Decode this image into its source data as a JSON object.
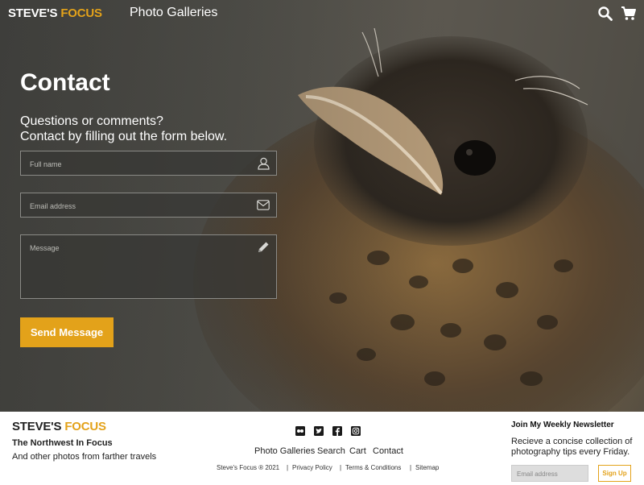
{
  "header": {
    "logo_part1": "STEVE'S",
    "logo_part2": "FOCUS",
    "nav_label": "Photo Galleries",
    "icons": [
      "search-icon",
      "cart-icon"
    ]
  },
  "contact": {
    "title": "Contact",
    "intro_line1": "Questions or comments?",
    "intro_line2": "Contact by filling out the form below.",
    "name_placeholder": "Full name",
    "email_placeholder": "Email address",
    "message_placeholder": "Message",
    "submit_label": "Send Message",
    "icons": [
      "user-icon",
      "envelope-icon",
      "pencil-icon"
    ]
  },
  "footer": {
    "logo_part1": "STEVE'S",
    "logo_part2": "FOCUS",
    "tagline": "The Northwest In Focus",
    "subtagline": "And other photos from farther travels",
    "social_icons": [
      "flickr-icon",
      "twitter-icon",
      "facebook-icon",
      "instagram-icon"
    ],
    "nav": [
      "Photo Galleries",
      "Search",
      "Cart",
      "Contact"
    ],
    "copyright": "Steve's Focus ® 2021",
    "legal_links": [
      "Privacy Policy",
      "Terms & Conditions",
      "Sitemap"
    ],
    "newsletter_title": "Join My Weekly Newsletter",
    "newsletter_desc": "Recieve a concise collection of photography tips every Friday.",
    "newsletter_placeholder": "Email address",
    "newsletter_button": "Sign Up"
  },
  "colors": {
    "accent": "#e3a21a",
    "footer_bg": "#ffffff"
  }
}
